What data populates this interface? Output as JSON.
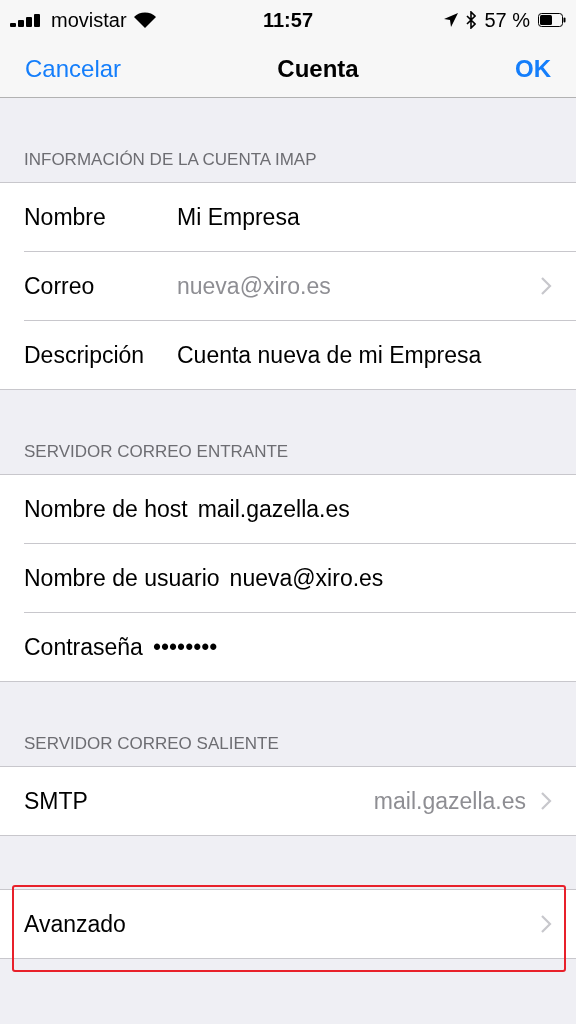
{
  "status_bar": {
    "carrier": "movistar",
    "time": "11:57",
    "battery": "57 %"
  },
  "nav": {
    "left": "Cancelar",
    "title": "Cuenta",
    "right": "OK"
  },
  "sections": [
    {
      "header": "INFORMACIÓN DE LA CUENTA IMAP",
      "kind": "column",
      "highlighted": false,
      "rows": [
        {
          "label": "Nombre",
          "value": "Mi Empresa",
          "dimmed": false,
          "chevron": false
        },
        {
          "label": "Correo",
          "value": "nueva@xiro.es",
          "dimmed": true,
          "chevron": true
        },
        {
          "label": "Descripción",
          "value": "Cuenta nueva de mi Empresa",
          "dimmed": false,
          "chevron": false
        }
      ]
    },
    {
      "header": "SERVIDOR CORREO ENTRANTE",
      "kind": "inline",
      "highlighted": false,
      "rows": [
        {
          "label": "Nombre de host",
          "value": "mail.gazella.es",
          "dimmed": false,
          "chevron": false
        },
        {
          "label": "Nombre de usuario",
          "value": "nueva@xiro.es",
          "dimmed": false,
          "chevron": false
        },
        {
          "label": "Contraseña",
          "value": "••••••••",
          "dimmed": false,
          "chevron": false
        }
      ]
    },
    {
      "header": "SERVIDOR CORREO SALIENTE",
      "kind": "detail",
      "highlighted": false,
      "rows": [
        {
          "label": "SMTP",
          "value": "mail.gazella.es",
          "dimmed": true,
          "chevron": true
        }
      ]
    },
    {
      "kind": "detail",
      "highlighted": true,
      "rows": [
        {
          "label": "Avanzado",
          "chevron": true
        }
      ]
    }
  ]
}
